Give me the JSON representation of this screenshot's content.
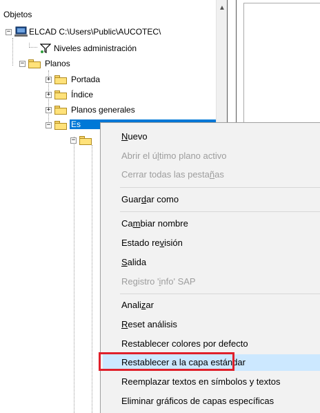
{
  "tree": {
    "header": "Objetos",
    "root": "ELCAD C:\\Users\\Public\\AUCOTEC\\",
    "admin": "Niveles administración",
    "planos": "Planos",
    "portada": "Portada",
    "indice": "Índice",
    "generales": "Planos generales",
    "selected": "Es"
  },
  "menu": {
    "items": [
      {
        "pre": "",
        "u": "N",
        "post": "uevo",
        "disabled": false
      },
      {
        "pre": "Abrir el ú",
        "u": "l",
        "post": "timo plano activo",
        "disabled": true
      },
      {
        "pre": "Cerrar todas las pesta",
        "u": "ñ",
        "post": "as",
        "disabled": true
      },
      {
        "pre": "Guar",
        "u": "d",
        "post": "ar como",
        "disabled": false
      },
      {
        "pre": "Ca",
        "u": "m",
        "post": "biar nombre",
        "disabled": false
      },
      {
        "pre": "Estado re",
        "u": "v",
        "post": "isión",
        "disabled": false
      },
      {
        "pre": "",
        "u": "S",
        "post": "alida",
        "disabled": false
      },
      {
        "pre": "Registro '",
        "u": "i",
        "post": "nfo' SAP",
        "disabled": true
      },
      {
        "pre": "Anali",
        "u": "z",
        "post": "ar",
        "disabled": false
      },
      {
        "pre": "",
        "u": "R",
        "post": "eset análisis",
        "disabled": false
      },
      {
        "pre": "Restablecer colores por defecto",
        "u": "",
        "post": "",
        "disabled": false
      },
      {
        "pre": "Restablecer a la capa estándar",
        "u": "",
        "post": "",
        "disabled": false
      },
      {
        "pre": "Reemplazar textos en símbolos y textos",
        "u": "",
        "post": "",
        "disabled": false
      },
      {
        "pre": "Eliminar gráficos de capas específicas",
        "u": "",
        "post": "",
        "disabled": false
      }
    ]
  },
  "colors": {
    "highlight": "#cce8ff",
    "annotation": "#e0202a",
    "selection": "#0078d7"
  }
}
